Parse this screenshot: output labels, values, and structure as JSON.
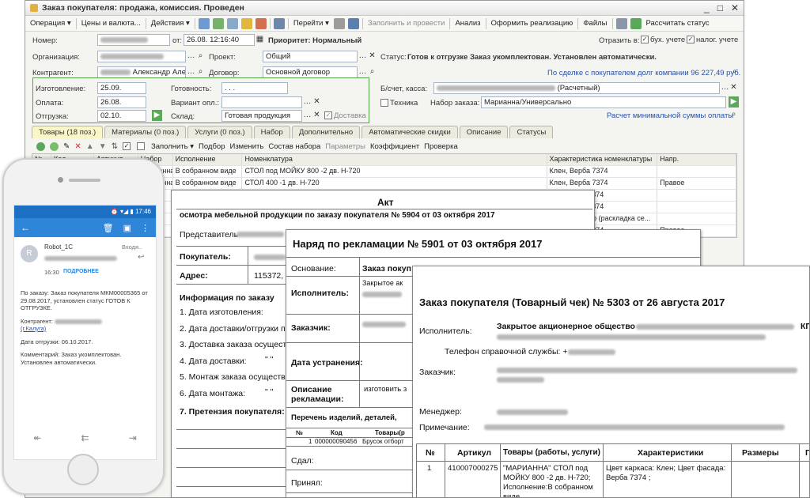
{
  "window": {
    "title": "Заказ покупателя: продажа, комиссия. Проведен",
    "controls": [
      "_",
      "□",
      "✕"
    ]
  },
  "toolbar": {
    "operation": "Операция ▾",
    "prices": "Цены и валюта...",
    "actions": "Действия ▾",
    "goto": "Перейти ▾",
    "fill_post": "Заполнить и провести",
    "analysis": "Анализ",
    "make_sale": "Оформить реализацию",
    "files": "Файлы",
    "calc_status": "Рассчитать статус"
  },
  "header": {
    "number_label": "Номер:",
    "date_from_label": "от:",
    "date_value": "26.08.",
    "time_value": "12:16:40",
    "priority": "Приоритет: Нормальный",
    "reflect_label": "Отразить в:",
    "buh_label": "бух. учете",
    "nalog_label": "налог. учете",
    "org_label": "Организация:",
    "project_label": "Проект:",
    "project_value": "Общий",
    "status_label": "Статус:",
    "status_value": "Готов к отгрузке  Заказ укомплектован. Установлен автоматически.",
    "contractor_label": "Контрагент:",
    "contractor_value": "Александр Алек",
    "contract_label": "Договор:",
    "contract_value": "Основной договор",
    "debt_link": "По сделке с покупателем долг компании 96 227,49 руб.",
    "manufacture_label": "Изготовление:",
    "manufacture_value": "25.09.",
    "ready_label": "Готовность:",
    "ready_value": ". . .",
    "payment_label": "Оплата:",
    "payment_value": "26.08.",
    "pay_variant_label": "Вариант опл.:",
    "shipment_label": "Отгрузка:",
    "shipment_value": "02.10.",
    "warehouse_label": "Склад:",
    "warehouse_value": "Готовая продукция",
    "delivery_label": "Доставка",
    "account_label": "Б/счет, касса:",
    "account_value": "(Расчетный)",
    "technique_label": "Техника",
    "order_set_label": "Набор заказа:",
    "order_set_value": "Марианна/Универсально",
    "min_sum_link": "Расчет минимальной суммы оплаты"
  },
  "tabs": [
    "Товары (18 поз.)",
    "Материалы (0 поз.)",
    "Услуги (0 поз.)",
    "Набор",
    "Дополнительно",
    "Автоматические скидки",
    "Описание",
    "Статусы"
  ],
  "grid_toolbar": {
    "fill": "Заполнить ▾",
    "select": "Подбор",
    "change": "Изменить",
    "set_composition": "Состав набора",
    "params": "Параметры",
    "coef": "Коэффициент",
    "check": "Проверка"
  },
  "grid": {
    "columns": [
      "№",
      "Код",
      "Артикул",
      "Набор",
      "Исполнение",
      "Номенклатура",
      "Характеристика номенклатуры",
      "Напр."
    ],
    "rows": [
      {
        "n": "",
        "code": "000000117",
        "art": "41000700",
        "set": "Марианна",
        "exec": "В собранном виде",
        "nom": "СТОЛ под МОЙКУ 800 -2 дв. Н-720",
        "char": "Клен, Верба 7374",
        "dir": ""
      },
      {
        "n": "",
        "code": "",
        "art": "41000700",
        "set": "Марианна",
        "exec": "В собранном виде",
        "nom": "СТОЛ 400 -1 дв. Н-720",
        "char": "Клен, Верба 7374",
        "dir": "Правое"
      },
      {
        "n": "",
        "code": "",
        "art": "",
        "set": "",
        "exec": "",
        "nom": "",
        "char": "лен, Верба 7374",
        "dir": ""
      },
      {
        "n": "",
        "code": "",
        "art": "",
        "set": "",
        "exec": "",
        "nom": "",
        "char": "лен, Верба 7374",
        "dir": ""
      },
      {
        "n": "",
        "code": "",
        "art": "",
        "set": "",
        "exec": "",
        "nom": "",
        "char": "точки серебро (раскладка се...",
        "dir": ""
      },
      {
        "n": "",
        "code": "",
        "art": "",
        "set": "",
        "exec": "",
        "nom": "",
        "char": "лен, Верба 7374",
        "dir": "Правое"
      }
    ]
  },
  "phone": {
    "time": "17:46",
    "sender": "Robot_1C",
    "folder": "Входя..",
    "time_sent": "16:30",
    "details": "ПОДРОБНЕЕ",
    "avatar_letter": "R",
    "body_1": "По заказу: Заказ покупателя МКМ00005365 от 29.08.2017, установлен статус ГОТОВ К ОТГРУЗКЕ.",
    "body_2_label": "Контрагент:",
    "body_2_city": "(г.Калуга)",
    "body_3": "Дата отгрузки: 06.10.2017.",
    "body_4": "Комментарий: Заказ укомплектован. Установлен автоматически."
  },
  "doc_act": {
    "title": "Акт",
    "subtitle": "осмотра мебельной продукции по заказу покупателя № 5904 от 03 октября 2017",
    "rep_label": "Представитель",
    "buyer_label": "Покупатель:",
    "address_label": "Адрес:",
    "address_value": "115372, М",
    "info_title": "Информация по заказу",
    "items": [
      "1. Дата изготовления:",
      "2. Дата доставки/отгрузки по",
      "3. Доставка заказа осуществ",
      "4. Дата доставки:",
      "5. Монтаж заказа осуществ",
      "6. Дата монтажа:"
    ],
    "claim_title": "7. Претензия покупателя:",
    "quote_marks": "\"      \""
  },
  "doc_claim": {
    "title": "Наряд по рекламации № 5901 от 03 октября 2017",
    "basis_label": "Основание:",
    "basis_value": "Заказ покуп",
    "executor_label": "Исполнитель:",
    "executor_value": "Закрытое ак",
    "customer_label": "Заказчик:",
    "fix_date_label": "Дата устранения:",
    "claim_desc_label": "Описание рекламации:",
    "claim_desc_value": "изготовить з",
    "list_title": "Перечень изделий, деталей,",
    "col_n": "№",
    "col_code": "Код",
    "col_goods": "Товары(р",
    "row_n": "1",
    "row_code": "000000090456",
    "row_goods": "Брусок отборт",
    "handed": "Сдал:",
    "accepted": "Принял:"
  },
  "doc_receipt": {
    "title": "Заказ покупателя (Товарный чек) № 5303 от 26 августа 2017",
    "executor_label": "Исполнитель:",
    "executor_value": "Закрытое акционерное общество",
    "executor_tail": "КП",
    "phone_label": "Телефон справочной службы: +",
    "customer_label": "Заказчик:",
    "manager_label": "Менеджер:",
    "note_label": "Примечание:",
    "columns": [
      "№",
      "Артикул",
      "Товары (работы, услуги)",
      "Характеристики",
      "Размеры",
      "П"
    ],
    "row": {
      "n": "1",
      "art": "410007000275",
      "goods": "\"МАРИАННА\" СТОЛ под МОЙКУ 800 -2 дв. Н-720; Исполнение:В собранном виде",
      "char": "Цвет каркаса: Клен; Цвет фасада: Верба 7374 ;"
    }
  }
}
